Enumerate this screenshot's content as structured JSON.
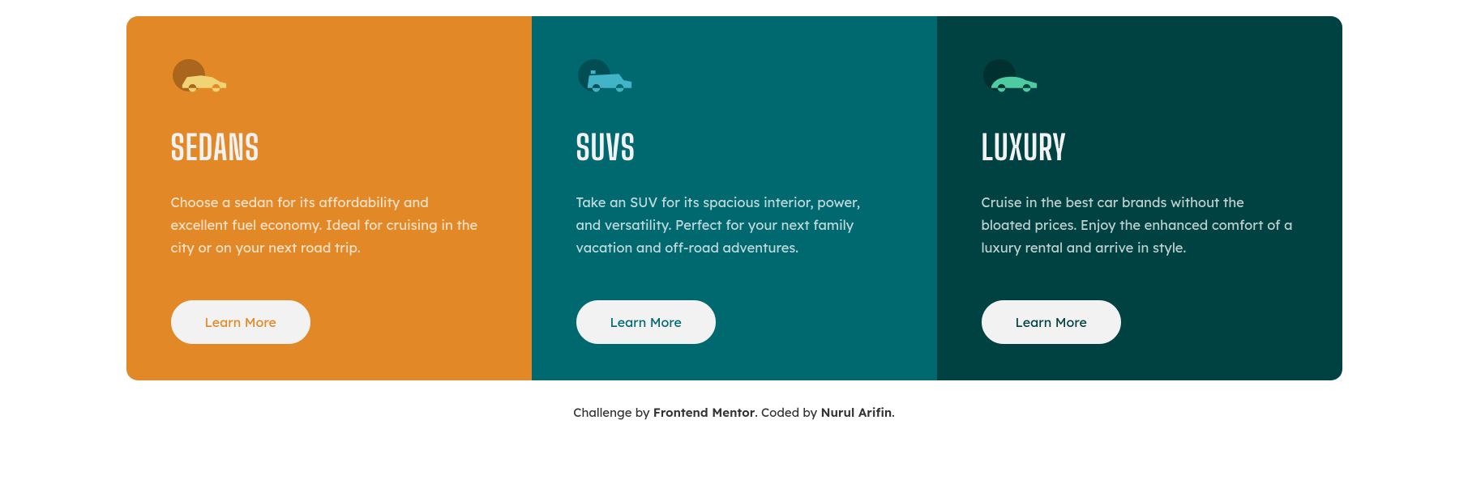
{
  "cards": [
    {
      "title": "Sedans",
      "desc": "Choose a sedan for its affordability and excellent fuel economy. Ideal for cruising in the city or on your next road trip.",
      "button": "Learn More"
    },
    {
      "title": "SUVs",
      "desc": "Take an SUV for its spacious interior, power, and versatility. Perfect for your next family vacation and off-road adventures.",
      "button": "Learn More"
    },
    {
      "title": "Luxury",
      "desc": "Cruise in the best car brands without the bloated prices. Enjoy the enhanced comfort of a luxury rental and arrive in style.",
      "button": "Learn More"
    }
  ],
  "attribution": {
    "prefix": "Challenge by ",
    "challenge_author": "Frontend Mentor",
    "middle": ". Coded by ",
    "coder": "Nurul Arifin",
    "suffix": "."
  }
}
